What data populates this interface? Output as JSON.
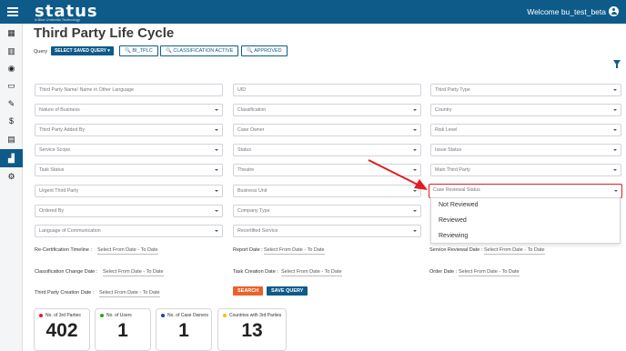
{
  "header": {
    "logo": "status",
    "logo_sub": "A Blue Umbrella Technology",
    "welcome": "Welcome bu_test_beta"
  },
  "sidebar": {
    "items": [
      {
        "icon": "dashboard-icon",
        "glyph": "▦"
      },
      {
        "icon": "building-icon",
        "glyph": "▥"
      },
      {
        "icon": "eye-icon",
        "glyph": "◉"
      },
      {
        "icon": "monitor-icon",
        "glyph": "▭"
      },
      {
        "icon": "edit-icon",
        "glyph": "✎"
      },
      {
        "icon": "dollar-icon",
        "glyph": "$"
      },
      {
        "icon": "document-icon",
        "glyph": "▤"
      },
      {
        "icon": "chart-icon",
        "glyph": "▟"
      },
      {
        "icon": "gear-icon",
        "glyph": "⚙"
      }
    ],
    "active_index": 7
  },
  "page": {
    "title": "Third Party Life Cycle"
  },
  "query": {
    "label": "Query",
    "saved_query_button": "SELECT SAVED QUERY ▾",
    "chips": [
      "🔍 BI_TPLC",
      "🔍 CLASSIFICATION ACTIVE",
      "🔍 APPROVED"
    ]
  },
  "fields": {
    "r1": [
      "Third Party Name/ Name in Other Language",
      "UID",
      "Third Party Type"
    ],
    "r2": [
      "Nature of Business",
      "Classification",
      "Country"
    ],
    "r3": [
      "Third Party Added By",
      "Case Owner",
      "Risk Level"
    ],
    "r4": [
      "Service Scope",
      "Status",
      "Issue Status"
    ],
    "r5": [
      "Task Status",
      "Theatre",
      "Main Third Party"
    ],
    "r6": [
      "Urgent Third Party",
      "Business Unit",
      "Case Reviewal Status"
    ],
    "r7": [
      "Ordered By",
      "Company Type",
      ""
    ],
    "r8": [
      "Language of Communication",
      "Recertified Service",
      ""
    ]
  },
  "dropdown": {
    "options": [
      "Not Reviewed",
      "Reviewed",
      "Reviewing"
    ]
  },
  "dates": {
    "placeholder": "Select From Date - To Date",
    "labels": [
      "Re-Certification Timeline :",
      "Report Date :",
      "Service Reviewal Date :",
      "Classification Change Date :",
      "Task Creation Date :",
      "Order Date :",
      "Third Party Creation Date :"
    ]
  },
  "actions": {
    "search": "SEARCH",
    "save_query": "SAVE QUERY"
  },
  "stats": [
    {
      "label": "No. of 3rd Parties",
      "value": "402",
      "color": "#e31b23"
    },
    {
      "label": "No. of Users",
      "value": "1",
      "color": "#2ca02c"
    },
    {
      "label": "No. of Case Owners",
      "value": "1",
      "color": "#1f3fa8"
    },
    {
      "label": "Countries with 3rd Parties",
      "value": "13",
      "color": "#f2c200"
    }
  ],
  "colors": {
    "brand": "#0e5b8a",
    "search_button": "#e8622a",
    "highlight": "#e31b23"
  }
}
